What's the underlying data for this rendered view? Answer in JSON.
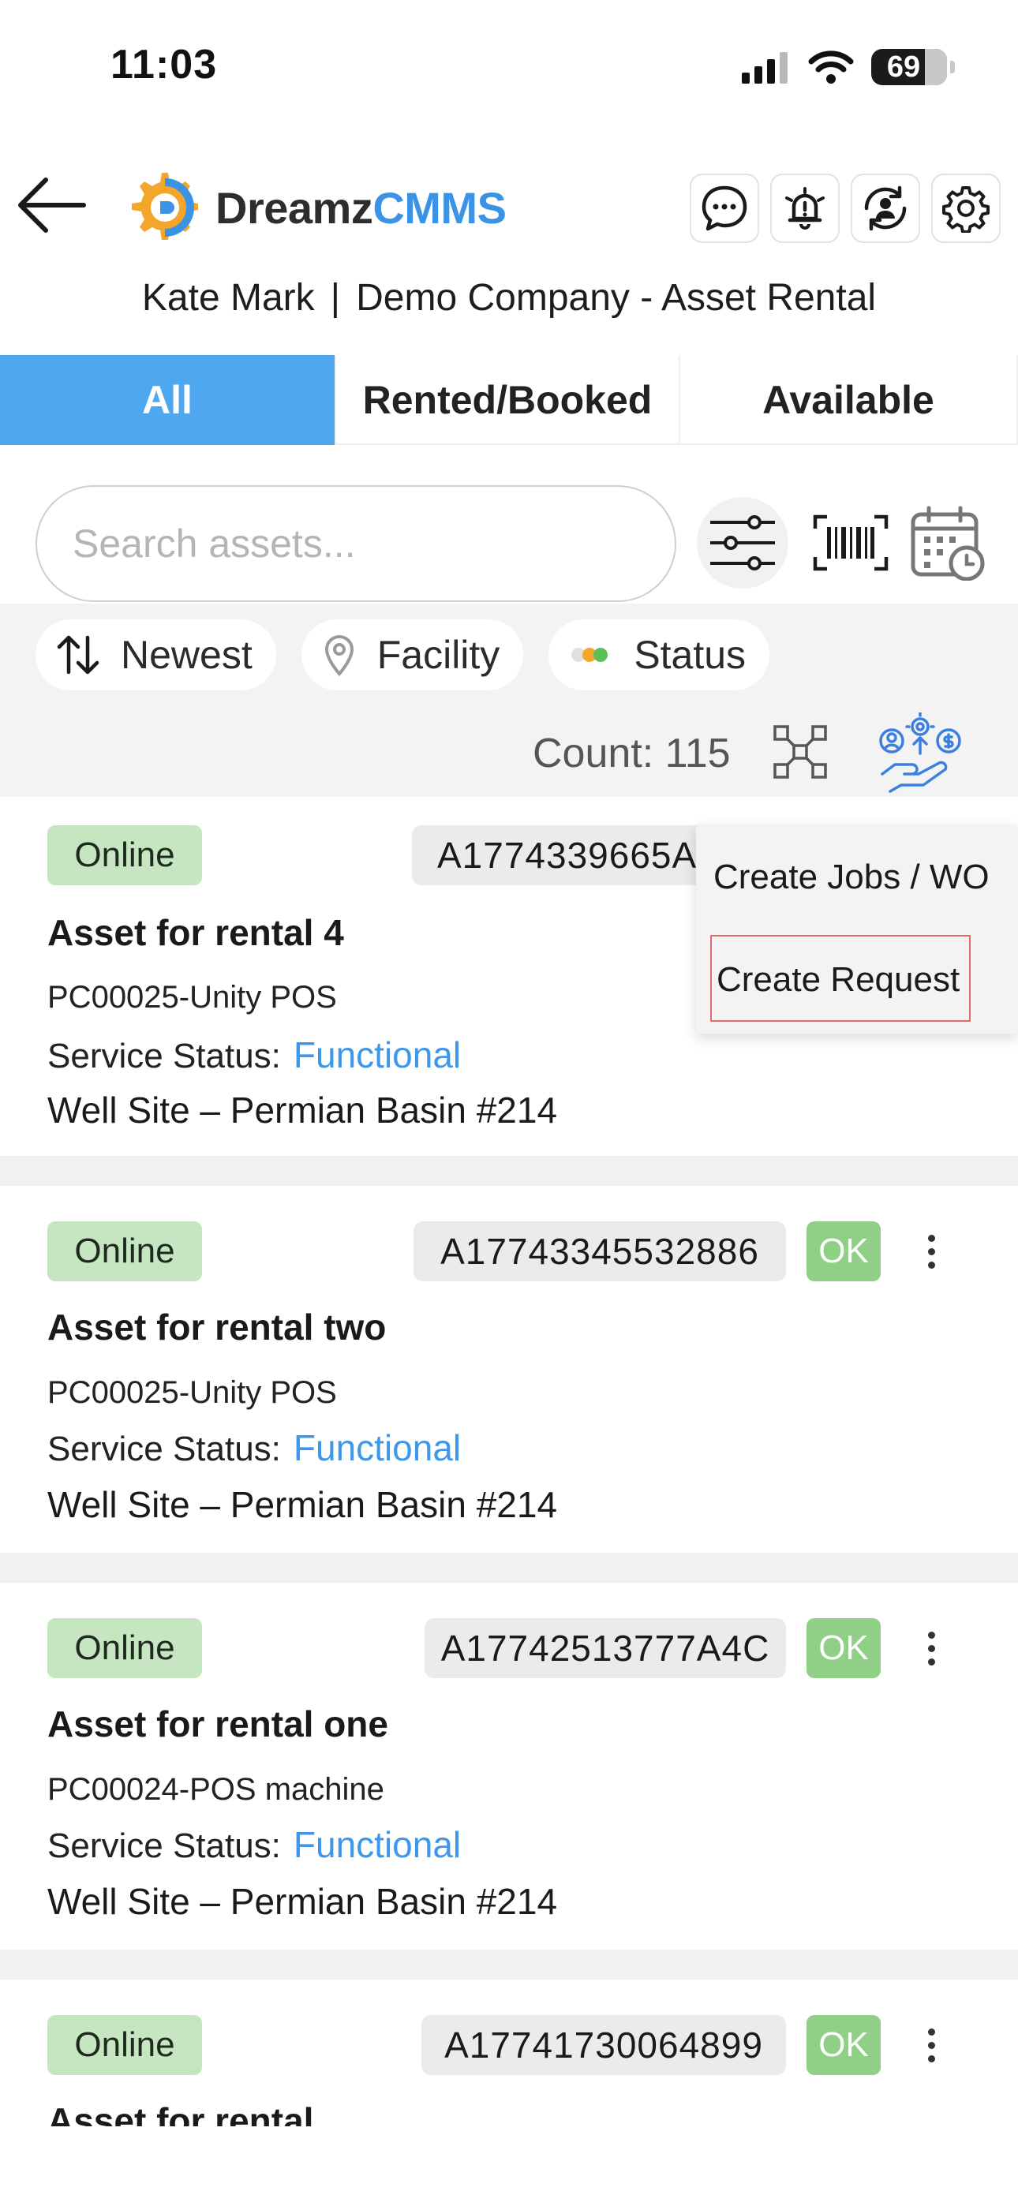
{
  "status_bar": {
    "time": "11:03",
    "battery": "69"
  },
  "header": {
    "logo_part1": "Dreamz",
    "logo_part2": "CMMS",
    "user_name": "Kate Mark",
    "separator": "|",
    "company": "Demo Company - Asset Rental"
  },
  "tabs": [
    {
      "label": "All",
      "active": true
    },
    {
      "label": "Rented/Booked",
      "active": false
    },
    {
      "label": "Available",
      "active": false
    }
  ],
  "search": {
    "placeholder": "Search assets..."
  },
  "chips": {
    "sort": "Newest",
    "facility": "Facility",
    "status": "Status"
  },
  "count_label": "Count: 115",
  "assets": [
    {
      "status": "Online",
      "id": "A1774339665A",
      "name": "Asset for rental 4",
      "code": "PC00025-Unity POS",
      "service_label": "Service Status:",
      "service_value": "Functional",
      "site": "Well Site – Permian Basin #214"
    },
    {
      "status": "Online",
      "id": "A17743345532886",
      "ok": "OK",
      "name": "Asset for rental two",
      "code": "PC00025-Unity POS",
      "service_label": "Service Status:",
      "service_value": "Functional",
      "site": "Well Site – Permian Basin #214"
    },
    {
      "status": "Online",
      "id": "A17742513777A4C",
      "ok": "OK",
      "name": "Asset for rental one",
      "code": "PC00024-POS machine",
      "service_label": "Service Status:",
      "service_value": "Functional",
      "site": "Well Site – Permian Basin #214"
    },
    {
      "status": "Online",
      "id": "A17741730064899",
      "ok": "OK",
      "name": "Asset for rental"
    }
  ],
  "menu": {
    "item1": "Create Jobs / WO",
    "item2": "Create Request"
  },
  "colors": {
    "accent": "#4ea7ef",
    "link": "#3e97ea",
    "online": "#c6e5c1",
    "ok": "#8fcf86"
  }
}
